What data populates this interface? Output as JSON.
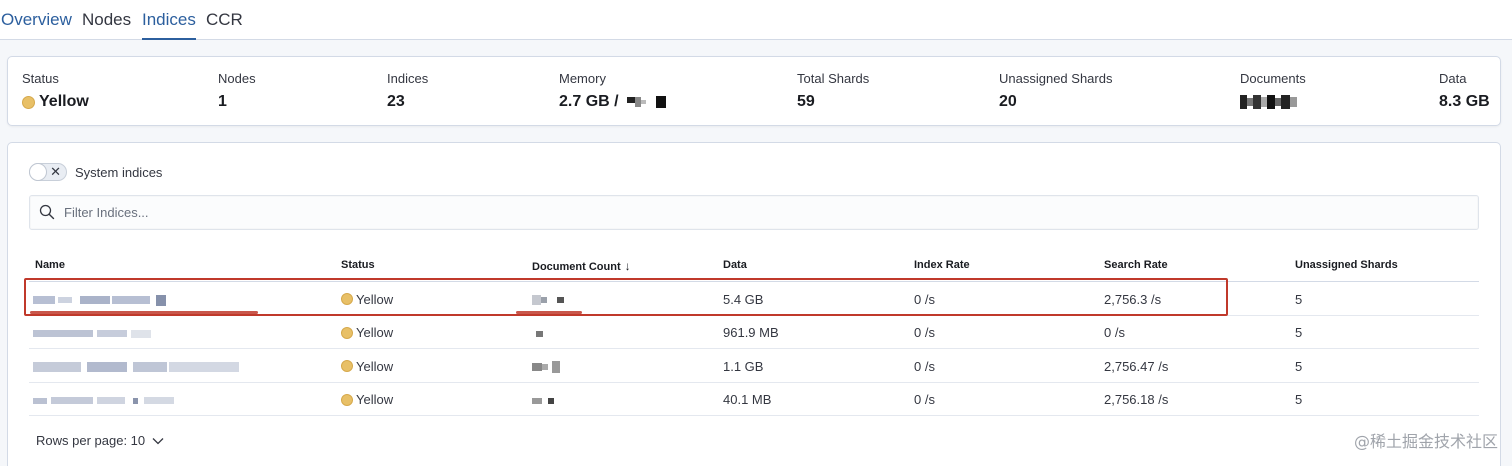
{
  "tabs": [
    {
      "label": "Overview"
    },
    {
      "label": "Nodes"
    },
    {
      "label": "Indices"
    },
    {
      "label": "CCR"
    }
  ],
  "summary": {
    "status_label": "Status",
    "status_value": "Yellow",
    "nodes_label": "Nodes",
    "nodes_value": "1",
    "indices_label": "Indices",
    "indices_value": "23",
    "memory_label": "Memory",
    "memory_value": "2.7 GB /",
    "total_shards_label": "Total Shards",
    "total_shards_value": "59",
    "unassigned_label": "Unassigned Shards",
    "unassigned_value": "20",
    "documents_label": "Documents",
    "data_label": "Data",
    "data_value": "8.3 GB"
  },
  "filters": {
    "system_indices_label": "System indices",
    "search_placeholder": "Filter Indices..."
  },
  "table": {
    "headers": {
      "name": "Name",
      "status": "Status",
      "document_count": "Document Count",
      "data": "Data",
      "index_rate": "Index Rate",
      "search_rate": "Search Rate",
      "unassigned_shards": "Unassigned Shards"
    },
    "rows": [
      {
        "status": "Yellow",
        "data": "5.4 GB",
        "index_rate": "0 /s",
        "search_rate": "2,756.3 /s",
        "unassigned": "5"
      },
      {
        "status": "Yellow",
        "data": "961.9 MB",
        "index_rate": "0 /s",
        "search_rate": "0 /s",
        "unassigned": "5"
      },
      {
        "status": "Yellow",
        "data": "1.1 GB",
        "index_rate": "0 /s",
        "search_rate": "2,756.47 /s",
        "unassigned": "5"
      },
      {
        "status": "Yellow",
        "data": "40.1 MB",
        "index_rate": "0 /s",
        "search_rate": "2,756.18 /s",
        "unassigned": "5"
      }
    ]
  },
  "pagination": {
    "rows_per_page": "Rows per page: 10"
  },
  "watermark": "@稀土掘金技术社区",
  "colors": {
    "accent": "#2c5f9e",
    "status_yellow": "#e8c067",
    "highlight_red": "#c0392b"
  },
  "icons": [
    "search-icon",
    "close-icon",
    "arrow-down-icon",
    "chevron-down-icon"
  ]
}
